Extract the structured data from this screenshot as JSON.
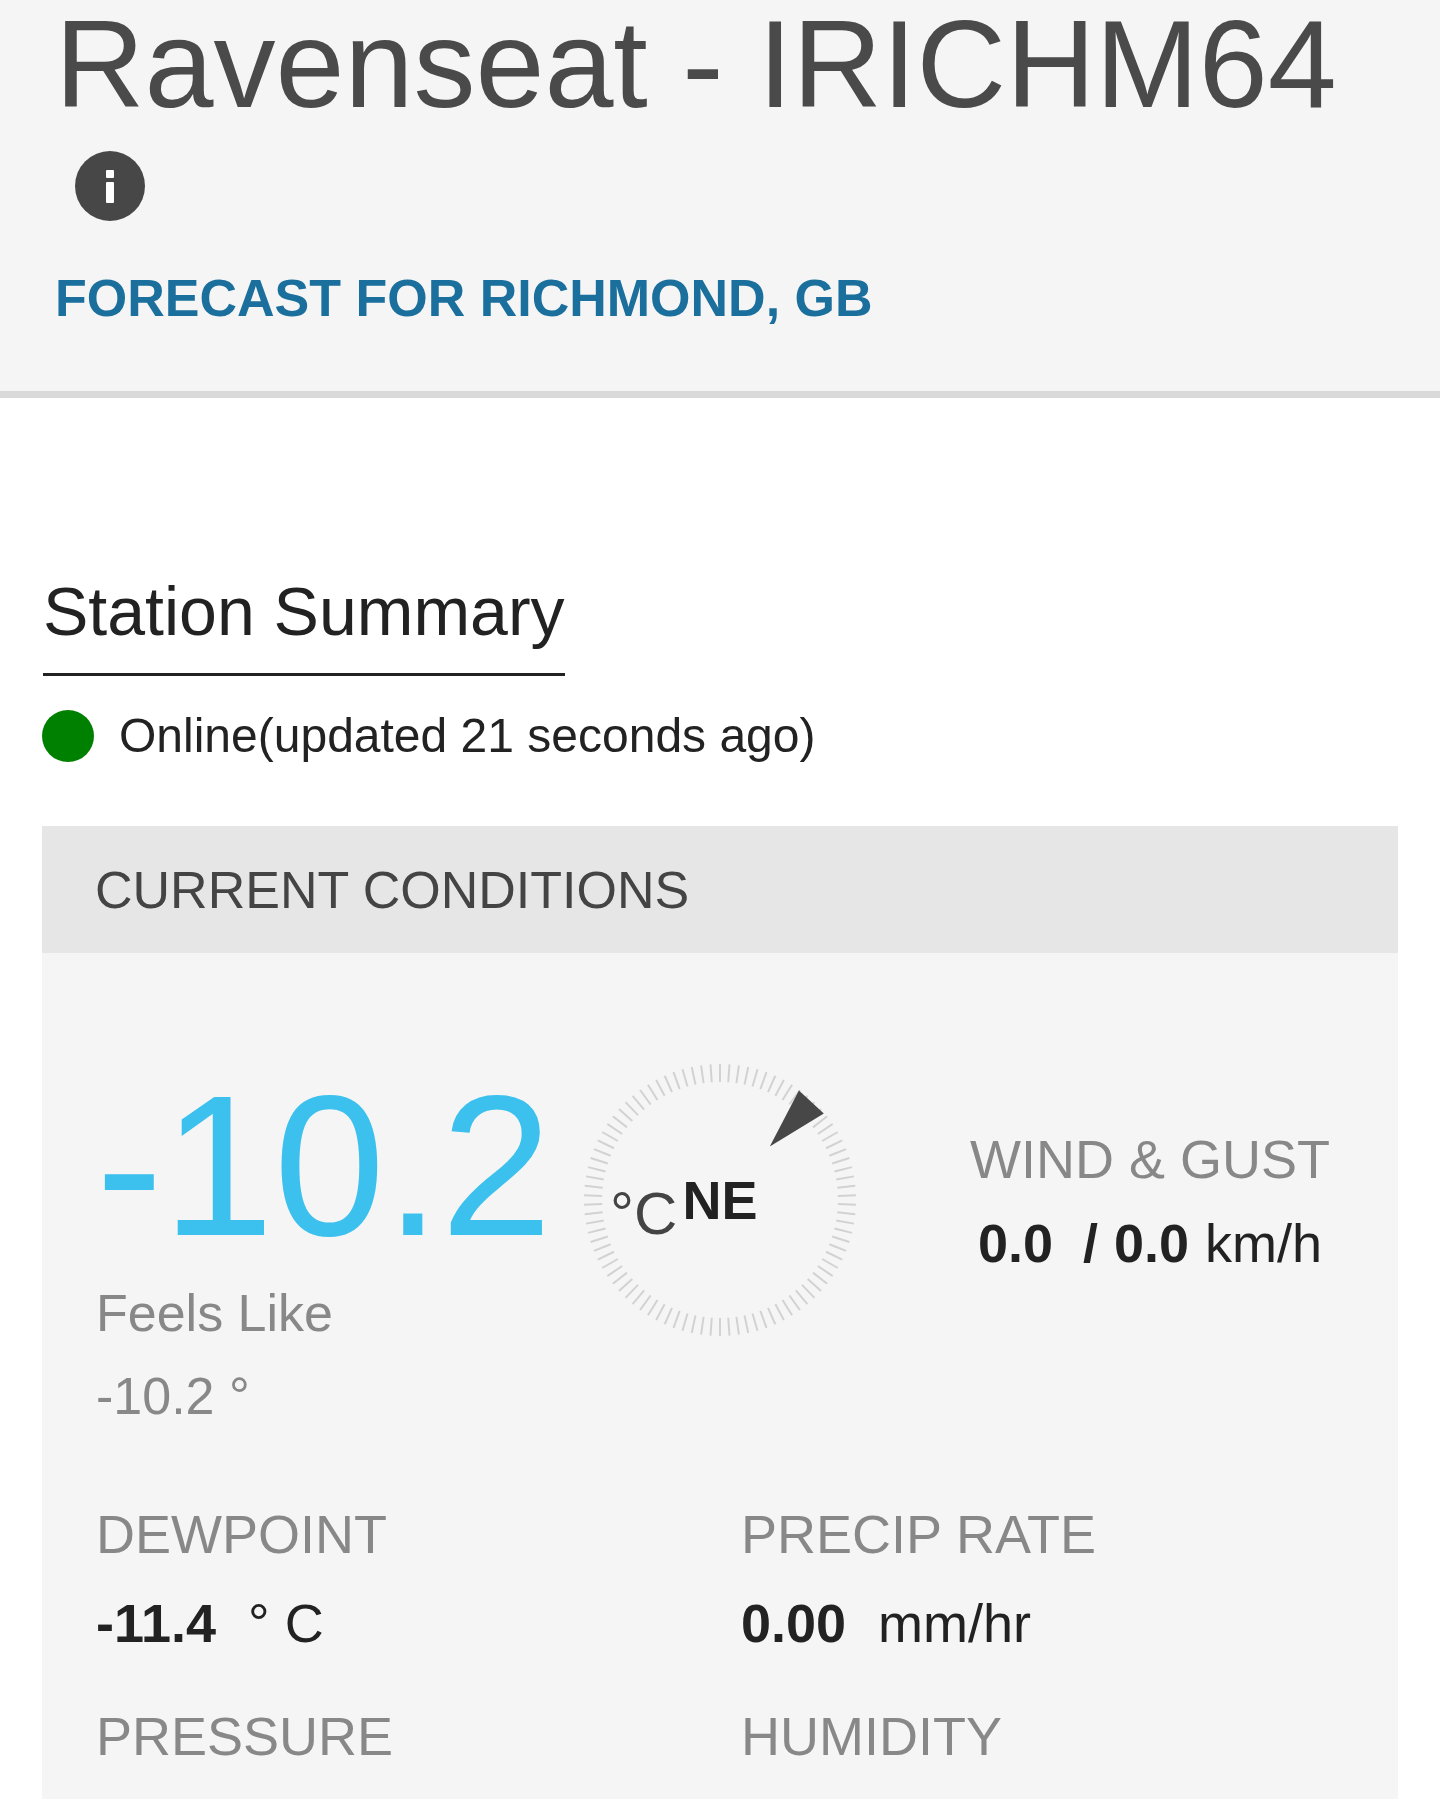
{
  "header": {
    "title": "Ravenseat - IRICHM64",
    "forecast_link": "FORECAST FOR RICHMOND, GB"
  },
  "station_summary": {
    "heading": "Station Summary",
    "status": {
      "online": true,
      "text": "Online(updated 21 seconds ago)"
    }
  },
  "current_conditions": {
    "heading": "CURRENT CONDITIONS",
    "temperature": {
      "value": "-10.2",
      "unit": "°C",
      "feels_like_label": "Feels Like",
      "feels_like_value": "-10.2 °"
    },
    "compass": {
      "direction": "NE"
    },
    "wind_gust": {
      "label": "WIND & GUST",
      "wind": "0.0",
      "separator": "/",
      "gust": "0.0",
      "unit": "km/h"
    },
    "metrics": [
      {
        "label": "DEWPOINT",
        "value": "-11.4",
        "unit": "° C"
      },
      {
        "label": "PRECIP RATE",
        "value": "0.00",
        "unit": "mm/hr"
      },
      {
        "label": "PRESSURE"
      },
      {
        "label": "HUMIDITY"
      }
    ]
  }
}
